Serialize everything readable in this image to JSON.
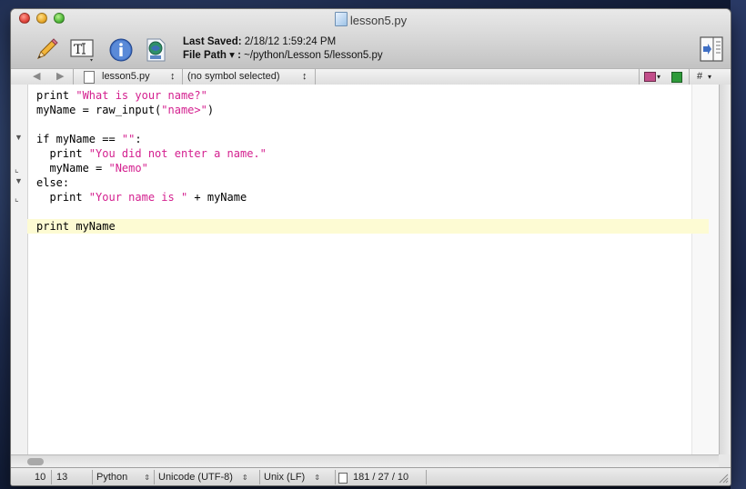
{
  "window": {
    "title": "lesson5.py"
  },
  "toolbar": {
    "last_saved_label": "Last Saved:",
    "last_saved_value": "2/18/12 1:59:24 PM",
    "file_path_label": "File Path ▾ :",
    "file_path_value": "~/python/Lesson 5/lesson5.py"
  },
  "navbar": {
    "back": "◀",
    "forward": "▶",
    "file_name": "lesson5.py",
    "file_arrows": "↕",
    "symbol": "(no symbol selected)",
    "symbol_arrows": "↕",
    "hash": "#",
    "hash_arrow": "▾"
  },
  "code": {
    "lines": [
      [
        "print ",
        "\"What is your name?\""
      ],
      [
        "myName = raw_input(",
        "\"name>\"",
        ")"
      ],
      [
        ""
      ],
      [
        "if myName == ",
        "\"\"",
        ":"
      ],
      [
        "  print ",
        "\"You did not enter a name.\""
      ],
      [
        "  myName = ",
        "\"Nemo\""
      ],
      [
        "else:"
      ],
      [
        "  print ",
        "\"Your name is \"",
        " + myName"
      ],
      [
        ""
      ],
      [
        "print myName"
      ]
    ]
  },
  "status": {
    "line": "10",
    "column": "13",
    "language": "Python",
    "encoding": "Unicode (UTF-8)",
    "line_endings": "Unix (LF)",
    "counts": "181 / 27 / 10"
  },
  "colors": {
    "string": "#d4208f",
    "current_line": "#fdfbd3"
  }
}
